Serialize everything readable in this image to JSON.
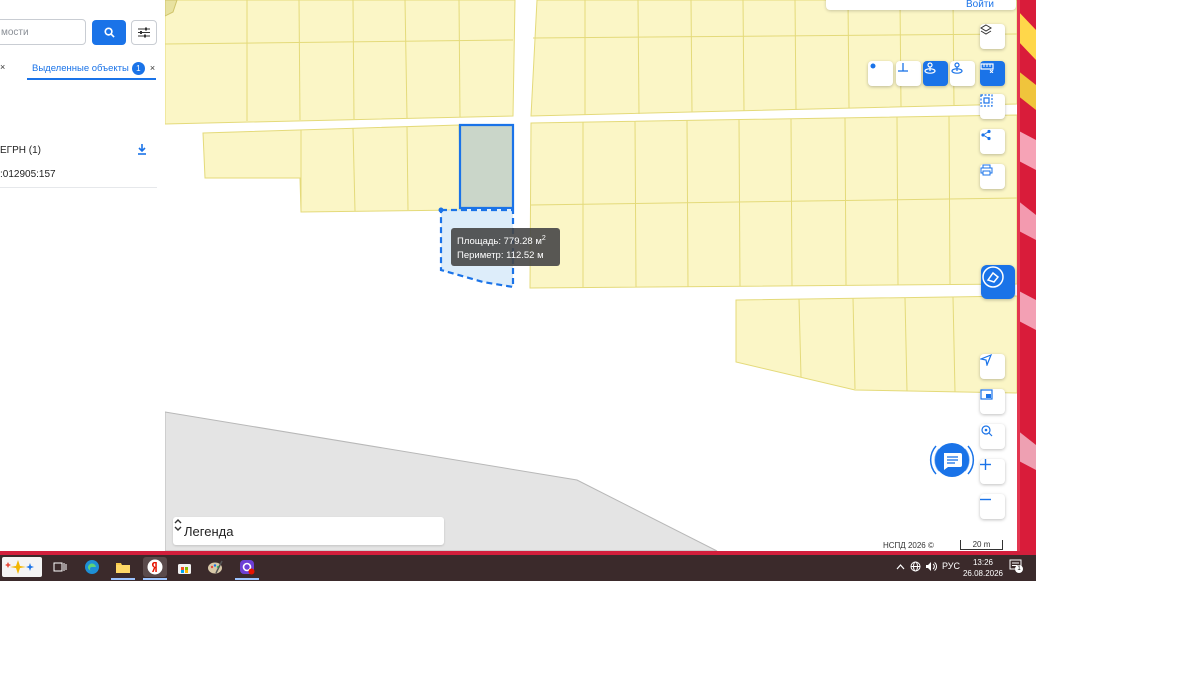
{
  "left_panel": {
    "search_placeholder": "мости",
    "tabs": [
      {
        "label": "",
        "close": "×"
      },
      {
        "label": "Выделенные объекты",
        "badge": "1",
        "close": "×"
      }
    ],
    "section_title": "ЕГРН (1)",
    "cadastral_number": ":012905:157"
  },
  "map": {
    "top_search_label": "Войти",
    "tooltip": {
      "area_label": "Площадь: 779.28 м",
      "area_sup": "2",
      "perimeter_label": "Периметр: 112.52 м"
    },
    "legend_label": "Легенда",
    "copyright": "НСПД 2026 ©",
    "scale_label": "20 m",
    "colors": {
      "parcel_fill": "#fbf6c6",
      "parcel_stroke": "#e4da7a",
      "selected_fill": "#cad6c9",
      "accent": "#1a73e8",
      "gray_area": "#e4e4e4"
    }
  },
  "taskbar": {
    "language": "РУС",
    "time": "13:26",
    "date": "26.08.2026",
    "notification_count": "1"
  }
}
